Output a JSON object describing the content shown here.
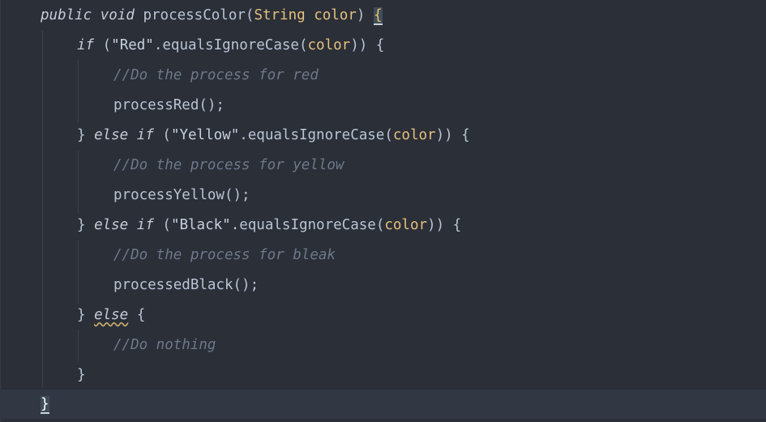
{
  "editor": {
    "language": "Java",
    "lines": [
      {
        "id": "l1",
        "tokens": [
          {
            "t": "public",
            "c": "kw"
          },
          {
            "t": " "
          },
          {
            "t": "void",
            "c": "kw"
          },
          {
            "t": " processColor("
          },
          {
            "t": "String",
            "c": "type"
          },
          {
            "t": " "
          },
          {
            "t": "color",
            "c": "param"
          },
          {
            "t": ") "
          },
          {
            "t": "{",
            "c": "brace-match"
          }
        ]
      },
      {
        "id": "l2",
        "tokens": [
          {
            "t": "if",
            "c": "kw"
          },
          {
            "t": " ("
          },
          {
            "t": "\"Red\"",
            "c": "str"
          },
          {
            "t": ".equalsIgnoreCase("
          },
          {
            "t": "color",
            "c": "var"
          },
          {
            "t": ")) {"
          }
        ]
      },
      {
        "id": "l3",
        "tokens": [
          {
            "t": "//Do the process for red",
            "c": "cmt"
          }
        ]
      },
      {
        "id": "l4",
        "tokens": [
          {
            "t": "processRed();"
          }
        ]
      },
      {
        "id": "l5",
        "tokens": [
          {
            "t": "} "
          },
          {
            "t": "else",
            "c": "kw"
          },
          {
            "t": " "
          },
          {
            "t": "if",
            "c": "kw"
          },
          {
            "t": " ("
          },
          {
            "t": "\"Yellow\"",
            "c": "str"
          },
          {
            "t": ".equalsIgnoreCase("
          },
          {
            "t": "color",
            "c": "var"
          },
          {
            "t": ")) {"
          }
        ]
      },
      {
        "id": "l6",
        "tokens": [
          {
            "t": "//Do the process for yellow",
            "c": "cmt"
          }
        ]
      },
      {
        "id": "l7",
        "tokens": [
          {
            "t": "processYellow();"
          }
        ]
      },
      {
        "id": "l8",
        "tokens": [
          {
            "t": "} "
          },
          {
            "t": "else",
            "c": "kw"
          },
          {
            "t": " "
          },
          {
            "t": "if",
            "c": "kw"
          },
          {
            "t": " ("
          },
          {
            "t": "\"Black\"",
            "c": "str"
          },
          {
            "t": ".equalsIgnoreCase("
          },
          {
            "t": "color",
            "c": "var"
          },
          {
            "t": ")) {"
          }
        ]
      },
      {
        "id": "l9",
        "tokens": [
          {
            "t": "//Do the process for bleak",
            "c": "cmt"
          }
        ]
      },
      {
        "id": "l10",
        "tokens": [
          {
            "t": "processedBlack();"
          }
        ]
      },
      {
        "id": "l11",
        "tokens": [
          {
            "t": "} "
          },
          {
            "t": "else",
            "c": "kw squiggle"
          },
          {
            "t": " {"
          }
        ]
      },
      {
        "id": "l12",
        "tokens": [
          {
            "t": "//Do nothing",
            "c": "cmt"
          }
        ]
      },
      {
        "id": "l13",
        "tokens": [
          {
            "t": "}"
          }
        ]
      },
      {
        "id": "l14",
        "tokens": [
          {
            "t": "}",
            "c": "brace-end"
          }
        ]
      }
    ],
    "colors": {
      "background": "#2b2f38",
      "current_line": "#323843",
      "keyword": "#c6ccd8",
      "parameter": "#e3c07e",
      "comment": "#6e7888",
      "text": "#b9c4d3"
    }
  }
}
